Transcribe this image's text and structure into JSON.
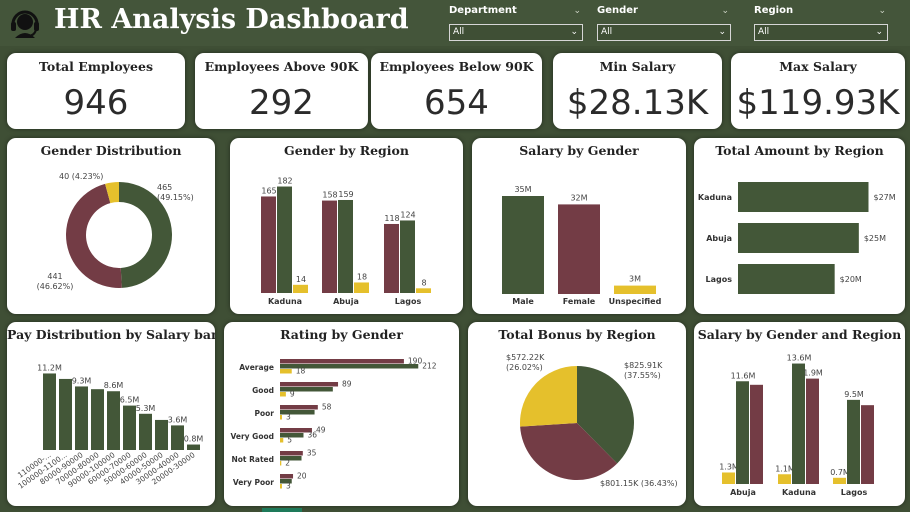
{
  "header": {
    "title": "HR Analysis Dashboard"
  },
  "slicers": [
    {
      "label": "Department",
      "value": "All"
    },
    {
      "label": "Gender",
      "value": "All"
    },
    {
      "label": "Region",
      "value": "All"
    }
  ],
  "kpis": [
    {
      "label": "Total Employees",
      "value": "946"
    },
    {
      "label": "Employees Above 90K",
      "value": "292"
    },
    {
      "label": "Employees Below 90K",
      "value": "654"
    },
    {
      "label": "Min Salary",
      "value": "$28.13K"
    },
    {
      "label": "Max Salary",
      "value": "$119.93K"
    }
  ],
  "colors": {
    "green": "#435738",
    "maroon": "#733c45",
    "yellow": "#e5c02c",
    "bg": "#3f4f35"
  },
  "chart_data": [
    {
      "id": "gender_distribution",
      "type": "pie",
      "title": "Gender Distribution",
      "donut": true,
      "slices": [
        {
          "label": "465 (49.15%)",
          "value": 465,
          "color": "#435738"
        },
        {
          "label": "441 (46.62%)",
          "value": 441,
          "color": "#733c45"
        },
        {
          "label": "40 (4.23%)",
          "value": 40,
          "color": "#e5c02c"
        }
      ]
    },
    {
      "id": "gender_by_region",
      "type": "bar",
      "title": "Gender by Region",
      "categories": [
        "Kaduna",
        "Abuja",
        "Lagos"
      ],
      "series": [
        {
          "values": [
            165,
            158,
            118
          ],
          "color": "#733c45"
        },
        {
          "values": [
            182,
            159,
            124
          ],
          "color": "#435738"
        },
        {
          "values": [
            14,
            18,
            8
          ],
          "color": "#e5c02c"
        }
      ],
      "ylim": [
        0,
        200
      ]
    },
    {
      "id": "salary_by_gender",
      "type": "bar",
      "title": "Salary by Gender",
      "categories": [
        "Male",
        "Female",
        "Unspecified"
      ],
      "values": [
        35,
        32,
        3
      ],
      "labels": [
        "35M",
        "32M",
        "3M"
      ],
      "colors": [
        "#435738",
        "#733c45",
        "#e5c02c"
      ],
      "ylim": [
        0,
        40
      ]
    },
    {
      "id": "total_amount_by_region",
      "type": "bar",
      "orientation": "horizontal",
      "title": "Total Amount by Region",
      "categories": [
        "Kaduna",
        "Abuja",
        "Lagos"
      ],
      "values": [
        27,
        25,
        20
      ],
      "labels": [
        "$27M",
        "$25M",
        "$20M"
      ],
      "color": "#435738",
      "xlim": [
        0,
        30
      ]
    },
    {
      "id": "pay_distribution",
      "type": "bar",
      "title": "Pay Distribution by Salary band",
      "categories": [
        "110000-...",
        "100000-1100...",
        "80000-90000",
        "70000-80000",
        "90000-100000",
        "60000-70000",
        "50000-60000",
        "40000-50000",
        "30000-40000",
        "20000-30000"
      ],
      "values": [
        11.2,
        10.4,
        9.3,
        8.9,
        8.6,
        6.5,
        5.3,
        4.4,
        3.6,
        0.8
      ],
      "labels": [
        "11.2M",
        "",
        "9.3M",
        "",
        "8.6M",
        "6.5M",
        "5.3M",
        "",
        "3.6M",
        "0.8M"
      ],
      "color": "#435738",
      "ylim": [
        0,
        12
      ]
    },
    {
      "id": "rating_by_gender",
      "type": "bar",
      "orientation": "horizontal",
      "title": "Rating by Gender",
      "categories": [
        "Average",
        "Good",
        "Poor",
        "Very Good",
        "Not Rated",
        "Very Poor"
      ],
      "series": [
        {
          "values": [
            190,
            89,
            58,
            49,
            35,
            20
          ],
          "color": "#733c45"
        },
        {
          "values": [
            212,
            81,
            53,
            36,
            33,
            18
          ],
          "color": "#435738"
        },
        {
          "values": [
            18,
            9,
            3,
            5,
            2,
            3
          ],
          "color": "#e5c02c"
        }
      ],
      "labels": [
        [
          "190",
          "212",
          "18"
        ],
        [
          "89",
          "",
          "9"
        ],
        [
          "58",
          "",
          "3"
        ],
        [
          "49",
          "36",
          "5"
        ],
        [
          "35",
          "",
          "2"
        ],
        [
          "20",
          "",
          "3"
        ]
      ],
      "xlim": [
        0,
        230
      ]
    },
    {
      "id": "total_bonus_by_region",
      "type": "pie",
      "title": "Total Bonus by Region",
      "slices": [
        {
          "label": "$825.91K (37.55%)",
          "value": 825.91,
          "color": "#435738"
        },
        {
          "label": "$801.15K (36.43%)",
          "value": 801.15,
          "color": "#733c45"
        },
        {
          "label": "$572.22K (26.02%)",
          "value": 572.22,
          "color": "#e5c02c"
        }
      ]
    },
    {
      "id": "salary_by_gender_region",
      "type": "bar",
      "title": "Salary by Gender and Region",
      "categories": [
        "Abuja",
        "Kaduna",
        "Lagos"
      ],
      "series": [
        {
          "values": [
            1.3,
            1.1,
            0.7
          ],
          "color": "#e5c02c"
        },
        {
          "values": [
            11.6,
            13.6,
            9.5
          ],
          "color": "#435738"
        },
        {
          "values": [
            11.2,
            11.9,
            8.9
          ],
          "color": "#733c45"
        }
      ],
      "labels": [
        [
          "1.3M",
          "11.6M",
          ""
        ],
        [
          "1.1M",
          "13.6M",
          "1.9M"
        ],
        [
          "0.7M",
          "9.5M",
          ""
        ]
      ],
      "ylim": [
        0,
        14
      ]
    }
  ]
}
